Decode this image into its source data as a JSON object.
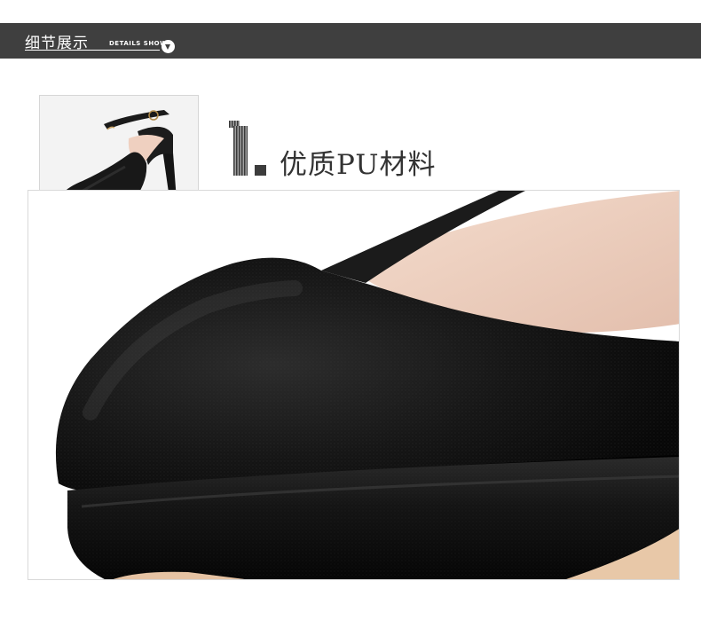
{
  "header": {
    "title": "细节展示",
    "subtitle": "DETAILS SHOW",
    "arrow_icon": "chevron-down-icon"
  },
  "section": {
    "number": "1.",
    "heading": "优质PU材料"
  },
  "thumbnail": {
    "subject": "shoe-thumbnail",
    "marker_icon": "highlight-square-icon"
  },
  "detail_photo": {
    "subject": "shoe-toe-closeup"
  },
  "colors": {
    "header_bg": "#3f3f3f",
    "header_text": "#ffffff",
    "heading_text": "#333333",
    "shoe_black": "#141414",
    "lining_pink": "#efd3c3"
  }
}
